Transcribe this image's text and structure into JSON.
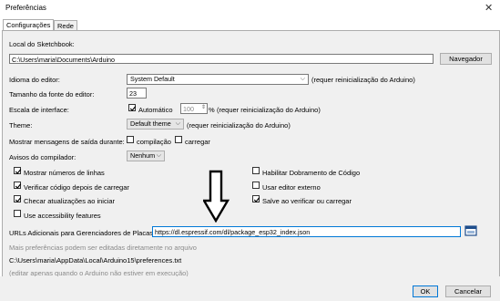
{
  "window": {
    "title": "Preferências"
  },
  "tabs": [
    {
      "label": "Configurações"
    },
    {
      "label": "Rede"
    }
  ],
  "sketchbook": {
    "label": "Local do Sketchbook:",
    "value": "C:\\Users\\maria\\Documents\\Arduino",
    "browse": "Navegador"
  },
  "language": {
    "label": "Idioma do editor:",
    "value": "System Default",
    "note": "(requer reinicialização do Arduino)"
  },
  "fontsize": {
    "label": "Tamanho da fonte do editor:",
    "value": "23"
  },
  "scale": {
    "label": "Escala de interface:",
    "auto": "Automático",
    "value": "100",
    "unit": "%",
    "note": "(requer reinicialização do Arduino)"
  },
  "theme": {
    "label": "Theme:",
    "value": "Default theme",
    "note": "(requer reinicialização do Arduino)"
  },
  "verbose": {
    "label": "Mostrar mensagens de saída durante:",
    "compile": "compilação",
    "upload": "carregar"
  },
  "warnings": {
    "label": "Avisos do compilador:",
    "value": "Nenhum"
  },
  "options_left": [
    {
      "label": "Mostrar números de linhas",
      "checked": true
    },
    {
      "label": "Verificar código depois de carregar",
      "checked": true
    },
    {
      "label": "Checar atualizações ao iniciar",
      "checked": true
    },
    {
      "label": "Use accessibility features",
      "checked": false
    }
  ],
  "options_right": [
    {
      "label": "Habilitar Dobramento de Código",
      "checked": false
    },
    {
      "label": "Usar editor externo",
      "checked": false
    },
    {
      "label": "Salve ao verificar ou carregar",
      "checked": true
    }
  ],
  "boards_url": {
    "label": "URLs Adicionais para Gerenciadores de Placas:",
    "value": "https://dl.espressif.com/dl/package_esp32_index.json"
  },
  "more_prefs": "Mais preferências podem ser editadas diretamente no arquivo",
  "prefs_path": "C:\\Users\\maria\\AppData\\Local\\Arduino15\\preferences.txt",
  "edit_note": "(editar apenas quando o Arduino não estiver em execução)",
  "buttons": {
    "ok": "OK",
    "cancel": "Cancelar"
  },
  "colors": {
    "accent": "#0078d7",
    "panel": "#f0f0f0"
  },
  "icons": [
    "close-icon",
    "chevron-down-icon",
    "checkmark-icon",
    "window-icon",
    "down-arrow-icon"
  ]
}
